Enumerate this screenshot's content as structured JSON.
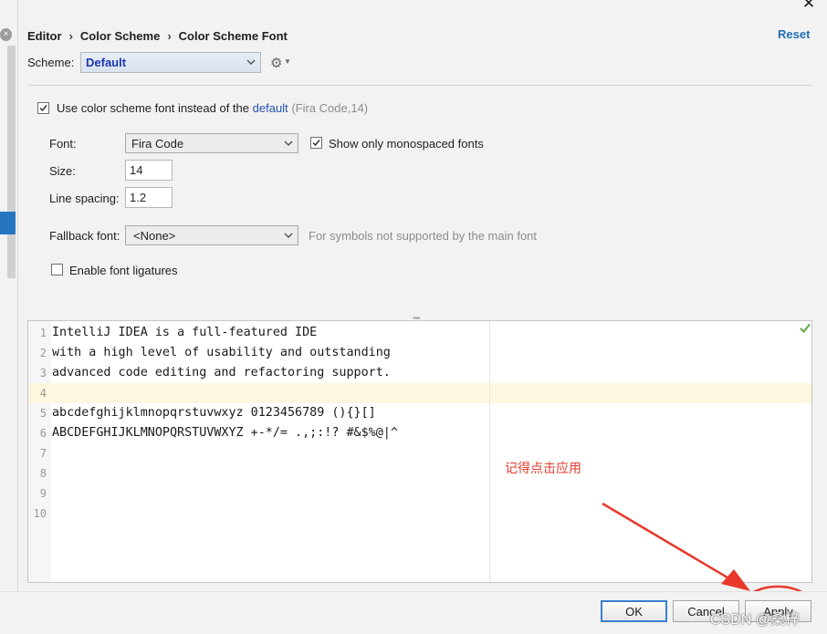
{
  "window": {
    "close_glyph": "✕"
  },
  "breadcrumb": [
    "Editor",
    "Color Scheme",
    "Color Scheme Font"
  ],
  "breadcrumb_separator": "›",
  "reset_label": "Reset",
  "scheme": {
    "label": "Scheme:",
    "value": "Default",
    "gear_icon": "gear-icon"
  },
  "use_scheme_font": {
    "checked": true,
    "label_prefix": "Use color scheme font instead of the",
    "default_link": "default",
    "hint": "(Fira Code,14)"
  },
  "font": {
    "label": "Font:",
    "value": "Fira Code"
  },
  "monospaced_only": {
    "checked": true,
    "label": "Show only monospaced fonts"
  },
  "size": {
    "label": "Size:",
    "value": "14"
  },
  "line_spacing": {
    "label": "Line spacing:",
    "value": "1.2"
  },
  "fallback_font": {
    "label": "Fallback font:",
    "value": "<None>",
    "hint": "For symbols not supported by the main font"
  },
  "ligatures": {
    "checked": false,
    "label": "Enable font ligatures"
  },
  "preview": {
    "lines": [
      {
        "num": "1",
        "text": "IntelliJ IDEA is a full-featured IDE"
      },
      {
        "num": "2",
        "text": "with a high level of usability and outstanding"
      },
      {
        "num": "3",
        "text": "advanced code editing and refactoring support."
      },
      {
        "num": "4",
        "text": ""
      },
      {
        "num": "5",
        "text": "abcdefghijklmnopqrstuvwxyz 0123456789 (){}[]"
      },
      {
        "num": "6",
        "text": "ABCDEFGHIJKLMNOPQRSTUVWXYZ +-*/= .,;:!? #&$%@|^"
      },
      {
        "num": "7",
        "text": ""
      },
      {
        "num": "8",
        "text": ""
      },
      {
        "num": "9",
        "text": ""
      },
      {
        "num": "10",
        "text": ""
      }
    ],
    "caret_line": 4
  },
  "annotation": "记得点击应用",
  "buttons": {
    "ok": "OK",
    "cancel": "Cancel",
    "apply": "Apply"
  },
  "watermark": "CSDN @桑梓",
  "colors": {
    "accent": "#2470b3",
    "annotation": "#e33b2e",
    "scheme_value": "#1a37b5"
  }
}
